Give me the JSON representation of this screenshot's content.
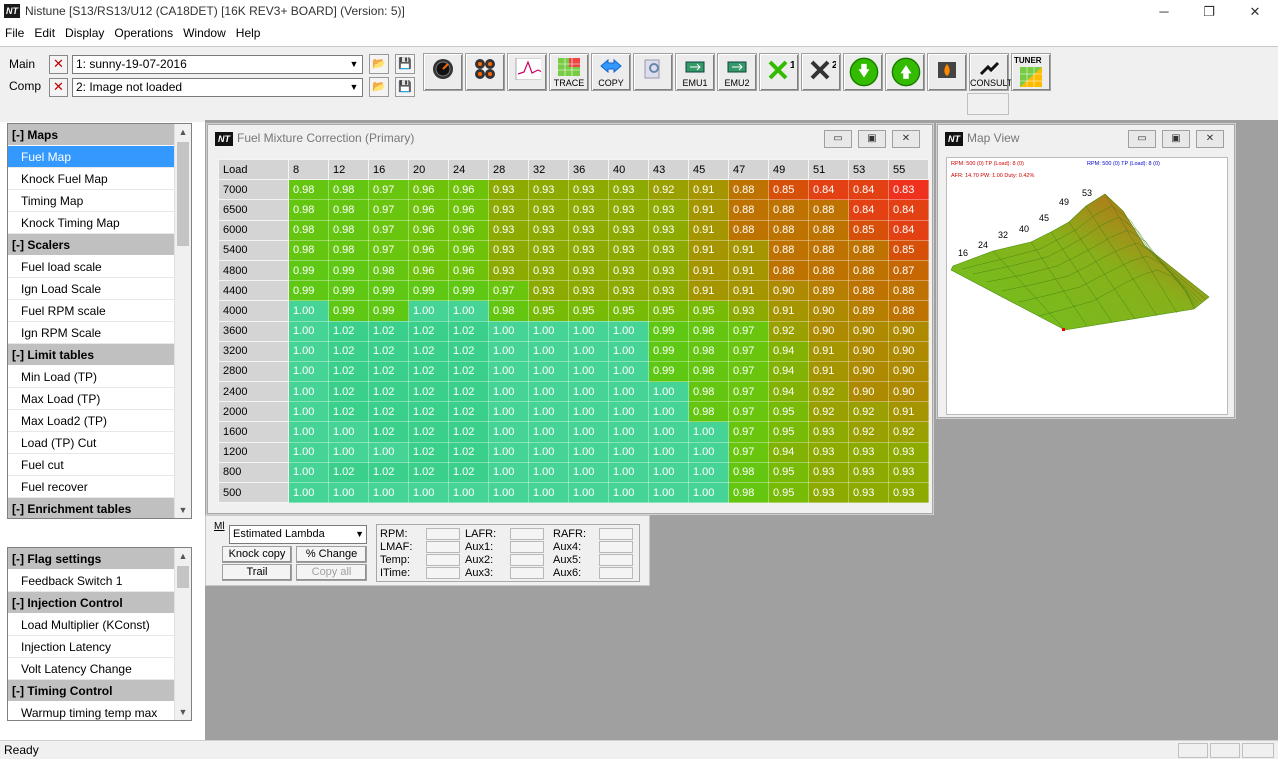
{
  "window": {
    "title": "Nistune [S13/RS13/U12 (CA18DET) [16K REV3+ BOARD] (Version: 5)]",
    "icon_text": "NT",
    "minimize": "─",
    "restore": "❐",
    "close": "✕"
  },
  "menu": [
    "File",
    "Edit",
    "Display",
    "Operations",
    "Window",
    "Help"
  ],
  "toolbar": {
    "main_label": "Main",
    "comp_label": "Comp",
    "main_value": "1: sunny-19-07-2016",
    "comp_value": "2: Image not loaded",
    "trace_label": "TRACE",
    "copy_label": "COPY",
    "emu1_label": "EMU1",
    "emu2_label": "EMU2",
    "consult_label": "CONSULT",
    "tuner_label": "TUNER",
    "colors": {
      "green_arrow": "#33bb00",
      "blue_arrow": "#3399ff"
    }
  },
  "sidebar_top": {
    "items": [
      {
        "type": "header",
        "label": "[-] Maps"
      },
      {
        "type": "item",
        "label": "Fuel Map",
        "selected": true
      },
      {
        "type": "item",
        "label": "Knock Fuel Map"
      },
      {
        "type": "item",
        "label": "Timing Map"
      },
      {
        "type": "item",
        "label": "Knock Timing Map"
      },
      {
        "type": "header",
        "label": "[-] Scalers"
      },
      {
        "type": "item",
        "label": "Fuel load scale"
      },
      {
        "type": "item",
        "label": "Ign Load Scale"
      },
      {
        "type": "item",
        "label": "Fuel RPM scale"
      },
      {
        "type": "item",
        "label": "Ign RPM Scale"
      },
      {
        "type": "header",
        "label": "[-] Limit tables"
      },
      {
        "type": "item",
        "label": "Min Load (TP)"
      },
      {
        "type": "item",
        "label": "Max Load (TP)"
      },
      {
        "type": "item",
        "label": "Max Load2 (TP)"
      },
      {
        "type": "item",
        "label": "Load (TP) Cut"
      },
      {
        "type": "item",
        "label": "Fuel cut"
      },
      {
        "type": "item",
        "label": "Fuel recover"
      },
      {
        "type": "header",
        "label": "[-] Enrichment tables"
      }
    ]
  },
  "sidebar_bottom": {
    "items": [
      {
        "type": "header",
        "label": "[-] Flag settings"
      },
      {
        "type": "item",
        "label": "Feedback Switch 1"
      },
      {
        "type": "header",
        "label": "[-] Injection Control"
      },
      {
        "type": "item",
        "label": "Load Multiplier (KConst)"
      },
      {
        "type": "item",
        "label": "Injection Latency"
      },
      {
        "type": "item",
        "label": "Volt Latency Change"
      },
      {
        "type": "header",
        "label": "[-] Timing Control"
      },
      {
        "type": "item",
        "label": "Warmup timing temp max"
      }
    ]
  },
  "fuel_window": {
    "title": "Fuel Mixture Correction (Primary)",
    "corner": "Load",
    "columns": [
      "8",
      "12",
      "16",
      "20",
      "24",
      "28",
      "32",
      "36",
      "40",
      "43",
      "45",
      "47",
      "49",
      "51",
      "53",
      "55"
    ],
    "rows": [
      {
        "rpm": "7000",
        "values": [
          "0.98",
          "0.98",
          "0.97",
          "0.96",
          "0.96",
          "0.93",
          "0.93",
          "0.93",
          "0.93",
          "0.92",
          "0.91",
          "0.88",
          "0.85",
          "0.84",
          "0.84",
          "0.83"
        ]
      },
      {
        "rpm": "6500",
        "values": [
          "0.98",
          "0.98",
          "0.97",
          "0.96",
          "0.96",
          "0.93",
          "0.93",
          "0.93",
          "0.93",
          "0.93",
          "0.91",
          "0.88",
          "0.88",
          "0.88",
          "0.84",
          "0.84"
        ]
      },
      {
        "rpm": "6000",
        "values": [
          "0.98",
          "0.98",
          "0.97",
          "0.96",
          "0.96",
          "0.93",
          "0.93",
          "0.93",
          "0.93",
          "0.93",
          "0.91",
          "0.88",
          "0.88",
          "0.88",
          "0.85",
          "0.84"
        ]
      },
      {
        "rpm": "5400",
        "values": [
          "0.98",
          "0.98",
          "0.97",
          "0.96",
          "0.96",
          "0.93",
          "0.93",
          "0.93",
          "0.93",
          "0.93",
          "0.91",
          "0.91",
          "0.88",
          "0.88",
          "0.88",
          "0.85"
        ]
      },
      {
        "rpm": "4800",
        "values": [
          "0.99",
          "0.99",
          "0.98",
          "0.96",
          "0.96",
          "0.93",
          "0.93",
          "0.93",
          "0.93",
          "0.93",
          "0.91",
          "0.91",
          "0.88",
          "0.88",
          "0.88",
          "0.87"
        ]
      },
      {
        "rpm": "4400",
        "values": [
          "0.99",
          "0.99",
          "0.99",
          "0.99",
          "0.99",
          "0.97",
          "0.93",
          "0.93",
          "0.93",
          "0.93",
          "0.91",
          "0.91",
          "0.90",
          "0.89",
          "0.88",
          "0.88"
        ]
      },
      {
        "rpm": "4000",
        "values": [
          "1.00",
          "0.99",
          "0.99",
          "1.00",
          "1.00",
          "0.98",
          "0.95",
          "0.95",
          "0.95",
          "0.95",
          "0.95",
          "0.93",
          "0.91",
          "0.90",
          "0.89",
          "0.88"
        ]
      },
      {
        "rpm": "3600",
        "values": [
          "1.00",
          "1.02",
          "1.02",
          "1.02",
          "1.02",
          "1.00",
          "1.00",
          "1.00",
          "1.00",
          "0.99",
          "0.98",
          "0.97",
          "0.92",
          "0.90",
          "0.90",
          "0.90"
        ]
      },
      {
        "rpm": "3200",
        "values": [
          "1.00",
          "1.02",
          "1.02",
          "1.02",
          "1.02",
          "1.00",
          "1.00",
          "1.00",
          "1.00",
          "0.99",
          "0.98",
          "0.97",
          "0.94",
          "0.91",
          "0.90",
          "0.90"
        ]
      },
      {
        "rpm": "2800",
        "values": [
          "1.00",
          "1.02",
          "1.02",
          "1.02",
          "1.02",
          "1.00",
          "1.00",
          "1.00",
          "1.00",
          "0.99",
          "0.98",
          "0.97",
          "0.94",
          "0.91",
          "0.90",
          "0.90"
        ]
      },
      {
        "rpm": "2400",
        "values": [
          "1.00",
          "1.02",
          "1.02",
          "1.02",
          "1.02",
          "1.00",
          "1.00",
          "1.00",
          "1.00",
          "1.00",
          "0.98",
          "0.97",
          "0.94",
          "0.92",
          "0.90",
          "0.90"
        ]
      },
      {
        "rpm": "2000",
        "values": [
          "1.00",
          "1.02",
          "1.02",
          "1.02",
          "1.02",
          "1.00",
          "1.00",
          "1.00",
          "1.00",
          "1.00",
          "0.98",
          "0.97",
          "0.95",
          "0.92",
          "0.92",
          "0.91"
        ]
      },
      {
        "rpm": "1600",
        "values": [
          "1.00",
          "1.00",
          "1.02",
          "1.02",
          "1.02",
          "1.00",
          "1.00",
          "1.00",
          "1.00",
          "1.00",
          "1.00",
          "0.97",
          "0.95",
          "0.93",
          "0.92",
          "0.92"
        ]
      },
      {
        "rpm": "1200",
        "values": [
          "1.00",
          "1.00",
          "1.00",
          "1.02",
          "1.02",
          "1.00",
          "1.00",
          "1.00",
          "1.00",
          "1.00",
          "1.00",
          "0.97",
          "0.94",
          "0.93",
          "0.93",
          "0.93"
        ]
      },
      {
        "rpm": "800",
        "values": [
          "1.00",
          "1.02",
          "1.02",
          "1.02",
          "1.02",
          "1.00",
          "1.00",
          "1.00",
          "1.00",
          "1.00",
          "1.00",
          "0.98",
          "0.95",
          "0.93",
          "0.93",
          "0.93"
        ]
      },
      {
        "rpm": "500",
        "values": [
          "1.00",
          "1.00",
          "1.00",
          "1.00",
          "1.00",
          "1.00",
          "1.00",
          "1.00",
          "1.00",
          "1.00",
          "1.00",
          "0.98",
          "0.95",
          "0.93",
          "0.93",
          "0.93"
        ]
      }
    ],
    "colors": {
      "teal": "#3fd68c",
      "green": "#55cc11",
      "olive": "#999900",
      "orange": "#cc6600",
      "red": "#ee3322"
    }
  },
  "map_view": {
    "title": "Map View",
    "rpm_left": "RPM: 500 (0)   TP (Load): 8 (0)",
    "afr_left": "AFR: 14.70   PW: 1.00   Duty: 0.42%",
    "rpm_right": "RPM: 500 (0)   TP (Load): 8 (0)",
    "axis_labels": [
      "16",
      "24",
      "32",
      "40",
      "45",
      "49",
      "53"
    ]
  },
  "dashboard": {
    "ml_label": "Ml",
    "mode_value": "Estimated Lambda",
    "knock_copy": "Knock copy",
    "pct_change": "% Change",
    "trail": "Trail",
    "copy_all": "Copy all",
    "gauges_col1": [
      "RPM:",
      "LMAF:",
      "Temp:",
      "ITime:"
    ],
    "gauges_col2": [
      "LAFR:",
      "Aux1:",
      "Aux2:",
      "Aux3:"
    ],
    "gauges_col3": [
      "RAFR:",
      "Aux4:",
      "Aux5:",
      "Aux6:"
    ]
  },
  "status": {
    "text": "Ready"
  }
}
